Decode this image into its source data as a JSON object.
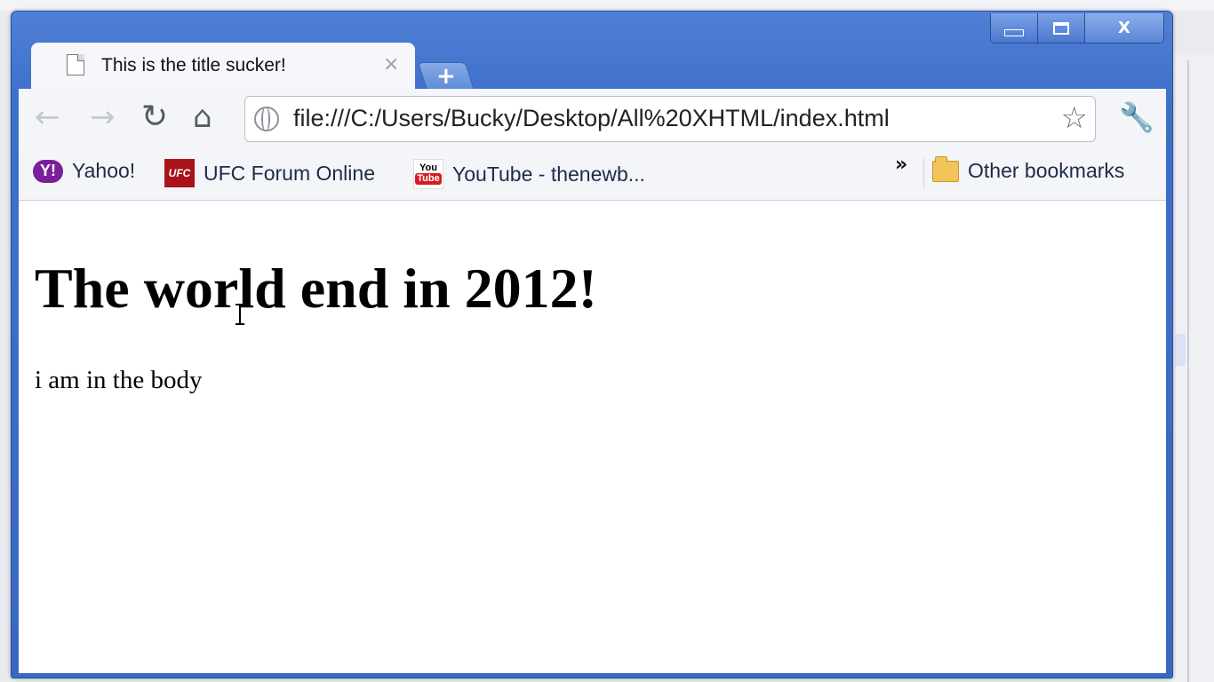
{
  "browser": {
    "tab": {
      "title": "This is the title sucker!",
      "close": "×"
    },
    "new_tab": "+",
    "caption": {
      "minimize": "minimize",
      "maximize": "maximize",
      "close": "X"
    },
    "nav": {
      "back": "←",
      "forward": "→",
      "reload": "↻",
      "home": "⌂"
    },
    "address_bar": {
      "url": "file:///C:/Users/Bucky/Desktop/All%20XHTML/index.html"
    },
    "bookmarks": [
      {
        "label": "Yahoo!",
        "icon": "yahoo-favicon"
      },
      {
        "label": "UFC Forum Online",
        "icon": "ufc-favicon"
      },
      {
        "label": "YouTube - thenewb...",
        "icon": "youtube-favicon"
      }
    ],
    "bookmarks_overflow": "»",
    "other_bookmarks": "Other bookmarks",
    "ufc_icon_text": "UFC",
    "yt_icon_top": "You",
    "yt_icon_bottom": "Tube",
    "yahoo_icon_text": "Y!"
  },
  "page": {
    "heading": "The world end in 2012!",
    "body": "i am in the body"
  }
}
